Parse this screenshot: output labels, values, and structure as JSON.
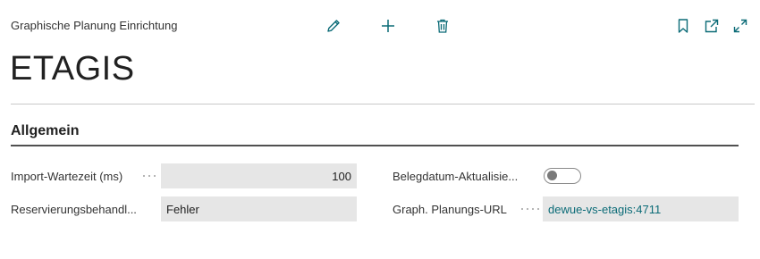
{
  "header": {
    "caption": "Graphische Planung Einrichtung",
    "title": "ETAGIS",
    "actions": {
      "edit_icon": "pencil-icon",
      "new_icon": "plus-icon",
      "delete_icon": "trash-icon",
      "bookmark_icon": "bookmark-icon",
      "open_new_window_icon": "open-in-new-window-icon",
      "expand_icon": "expand-icon"
    }
  },
  "section": {
    "title": "Allgemein"
  },
  "fields": {
    "import_wait": {
      "label": "Import-Wartezeit (ms)",
      "value": "100"
    },
    "reservation": {
      "label": "Reservierungsbehandl...",
      "value": "Fehler"
    },
    "doc_date_update": {
      "label": "Belegdatum-Aktualisie...",
      "toggled": false
    },
    "planning_url": {
      "label": "Graph. Planungs-URL",
      "value": "dewue-vs-etagis:4711"
    }
  },
  "colors": {
    "accent": "#0b6b77",
    "field_bg": "#e6e6e6"
  }
}
